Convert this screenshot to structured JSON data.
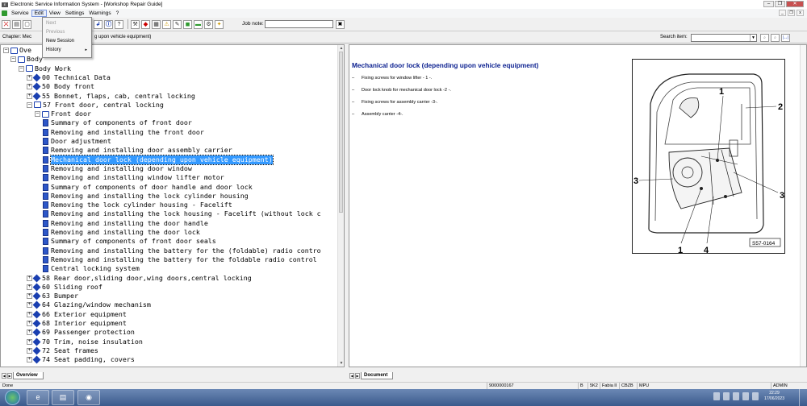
{
  "window": {
    "title": "Electronic Service Information System - [Workshop Repair Guide]",
    "controls": [
      "–",
      "❐",
      "✕"
    ]
  },
  "menu": {
    "items": [
      "Service",
      "Edit",
      "View",
      "Settings",
      "Warnings",
      "?"
    ],
    "mdi_controls": [
      "_",
      "❐",
      "x"
    ]
  },
  "edit_menu": {
    "items": [
      {
        "label": "Next"
      },
      {
        "label": "Previous"
      },
      {
        "label": "New Session"
      },
      {
        "label": "History",
        "arrow": "▸"
      }
    ]
  },
  "toolbar": {
    "job_note_label": "Job note:",
    "job_note_value": ""
  },
  "chapter": {
    "text_left": "Chapter: Mec",
    "text_right": "g upon vehicle equipment)",
    "search_label": "Search item:",
    "search_value": ""
  },
  "tree": {
    "items": [
      {
        "label": "Ove",
        "exp": "–"
      },
      {
        "label": "Body",
        "exp": "–"
      },
      {
        "label": "Body Work",
        "exp": "–"
      },
      {
        "label": "00 Technical Data",
        "exp": "+"
      },
      {
        "label": "50 Body front",
        "exp": "+"
      },
      {
        "label": "55 Bonnet, flaps, cab, central locking",
        "exp": "+"
      },
      {
        "label": "57 Front door, central locking",
        "exp": "–"
      },
      {
        "label": "Front door",
        "exp": "–"
      },
      {
        "label": "Summary of components of front door"
      },
      {
        "label": "Removing and installing the front door"
      },
      {
        "label": "Door adjustment"
      },
      {
        "label": "Removing and installing door assembly carrier"
      },
      {
        "label": "Mechanical door lock (depending upon vehicle equipment)",
        "selected": true
      },
      {
        "label": "Removing and installing door window"
      },
      {
        "label": "Removing and installing window lifter motor"
      },
      {
        "label": "Summary of components of door handle and door lock"
      },
      {
        "label": "Removing and installing the lock cylinder housing"
      },
      {
        "label": "Removing the lock cylinder housing - Facelift"
      },
      {
        "label": "Removing and installing the lock housing - Facelift (without lock c"
      },
      {
        "label": "Removing and installing the door handle"
      },
      {
        "label": "Removing and installing the door lock"
      },
      {
        "label": "Summary of components of front door seals"
      },
      {
        "label": "Removing and installing the battery for the (foldable) radio contro"
      },
      {
        "label": "Removing and installing the battery for the foldable radio control"
      },
      {
        "label": "Central locking system"
      },
      {
        "label": "58 Rear door,sliding door,wing doors,central locking",
        "exp": "+"
      },
      {
        "label": "60 Sliding roof",
        "exp": "+"
      },
      {
        "label": "63 Bumper",
        "exp": "+"
      },
      {
        "label": "64 Glazing/window mechanism",
        "exp": "+"
      },
      {
        "label": "66 Exterior equipment",
        "exp": "+"
      },
      {
        "label": "68 Interior equipment",
        "exp": "+"
      },
      {
        "label": "69 Passenger protection",
        "exp": "+"
      },
      {
        "label": "70 Trim, noise insulation",
        "exp": "+"
      },
      {
        "label": "72 Seat frames",
        "exp": "+"
      },
      {
        "label": "74 Seat padding, covers",
        "exp": "+"
      }
    ],
    "tab_label": "Overview"
  },
  "document": {
    "title": "Mechanical door lock (depending upon vehicle equipment)",
    "items": [
      "Fixing screws for window lifter - 1 -.",
      "Door lock knob for mechanical door lock -2 -.",
      "Fixing screws for assembly carrier -3-.",
      "Assembly carrier -4-."
    ],
    "figure": {
      "callouts": [
        "1",
        "2",
        "3",
        "3",
        "1",
        "4"
      ],
      "ref": "S57-0164"
    },
    "tab_label": "Document"
  },
  "status": {
    "left": "Done",
    "doc_id": "9000000167",
    "cells": [
      "B",
      "5K2",
      "Fabia II",
      "CBZB",
      "MPU"
    ],
    "user": "ADMIN"
  },
  "taskbar": {
    "time": "22:29",
    "date": "17/06/2023"
  }
}
